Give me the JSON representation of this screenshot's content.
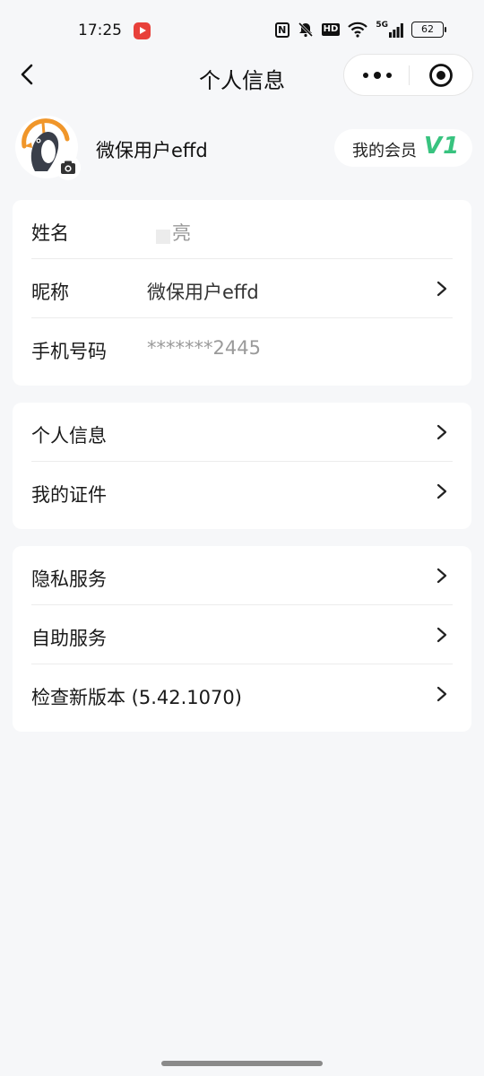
{
  "status_bar": {
    "time": "17:25",
    "icons": [
      "nfc-icon",
      "mute-icon",
      "hd-icon",
      "wifi-icon",
      "5g-signal-icon"
    ],
    "hd": "HD",
    "network": "5G",
    "battery": "62"
  },
  "nav": {
    "title": "个人信息",
    "back_icon": "back-chevron-icon",
    "more_icon": "more-dots-icon",
    "close_icon": "target-close-icon"
  },
  "profile": {
    "username": "微保用户effd",
    "member_label": "我的会员",
    "member_level": "V1",
    "colors": {
      "level": "#38c37f",
      "avatar_ring": "#f0962a"
    }
  },
  "card_basic": {
    "rows": [
      {
        "label": "姓名",
        "value": "亮",
        "value_muted": true,
        "has_arrow": false
      },
      {
        "label": "昵称",
        "value": "微保用户effd",
        "value_muted": false,
        "has_arrow": true
      },
      {
        "label": "手机号码",
        "value": "*******2445",
        "value_muted": true,
        "has_arrow": false
      }
    ]
  },
  "card_info": {
    "rows": [
      {
        "label": "个人信息"
      },
      {
        "label": "我的证件"
      }
    ]
  },
  "card_services": {
    "rows": [
      {
        "label": "隐私服务"
      },
      {
        "label": "自助服务"
      },
      {
        "label": "检查新版本 (5.42.1070)"
      }
    ]
  }
}
